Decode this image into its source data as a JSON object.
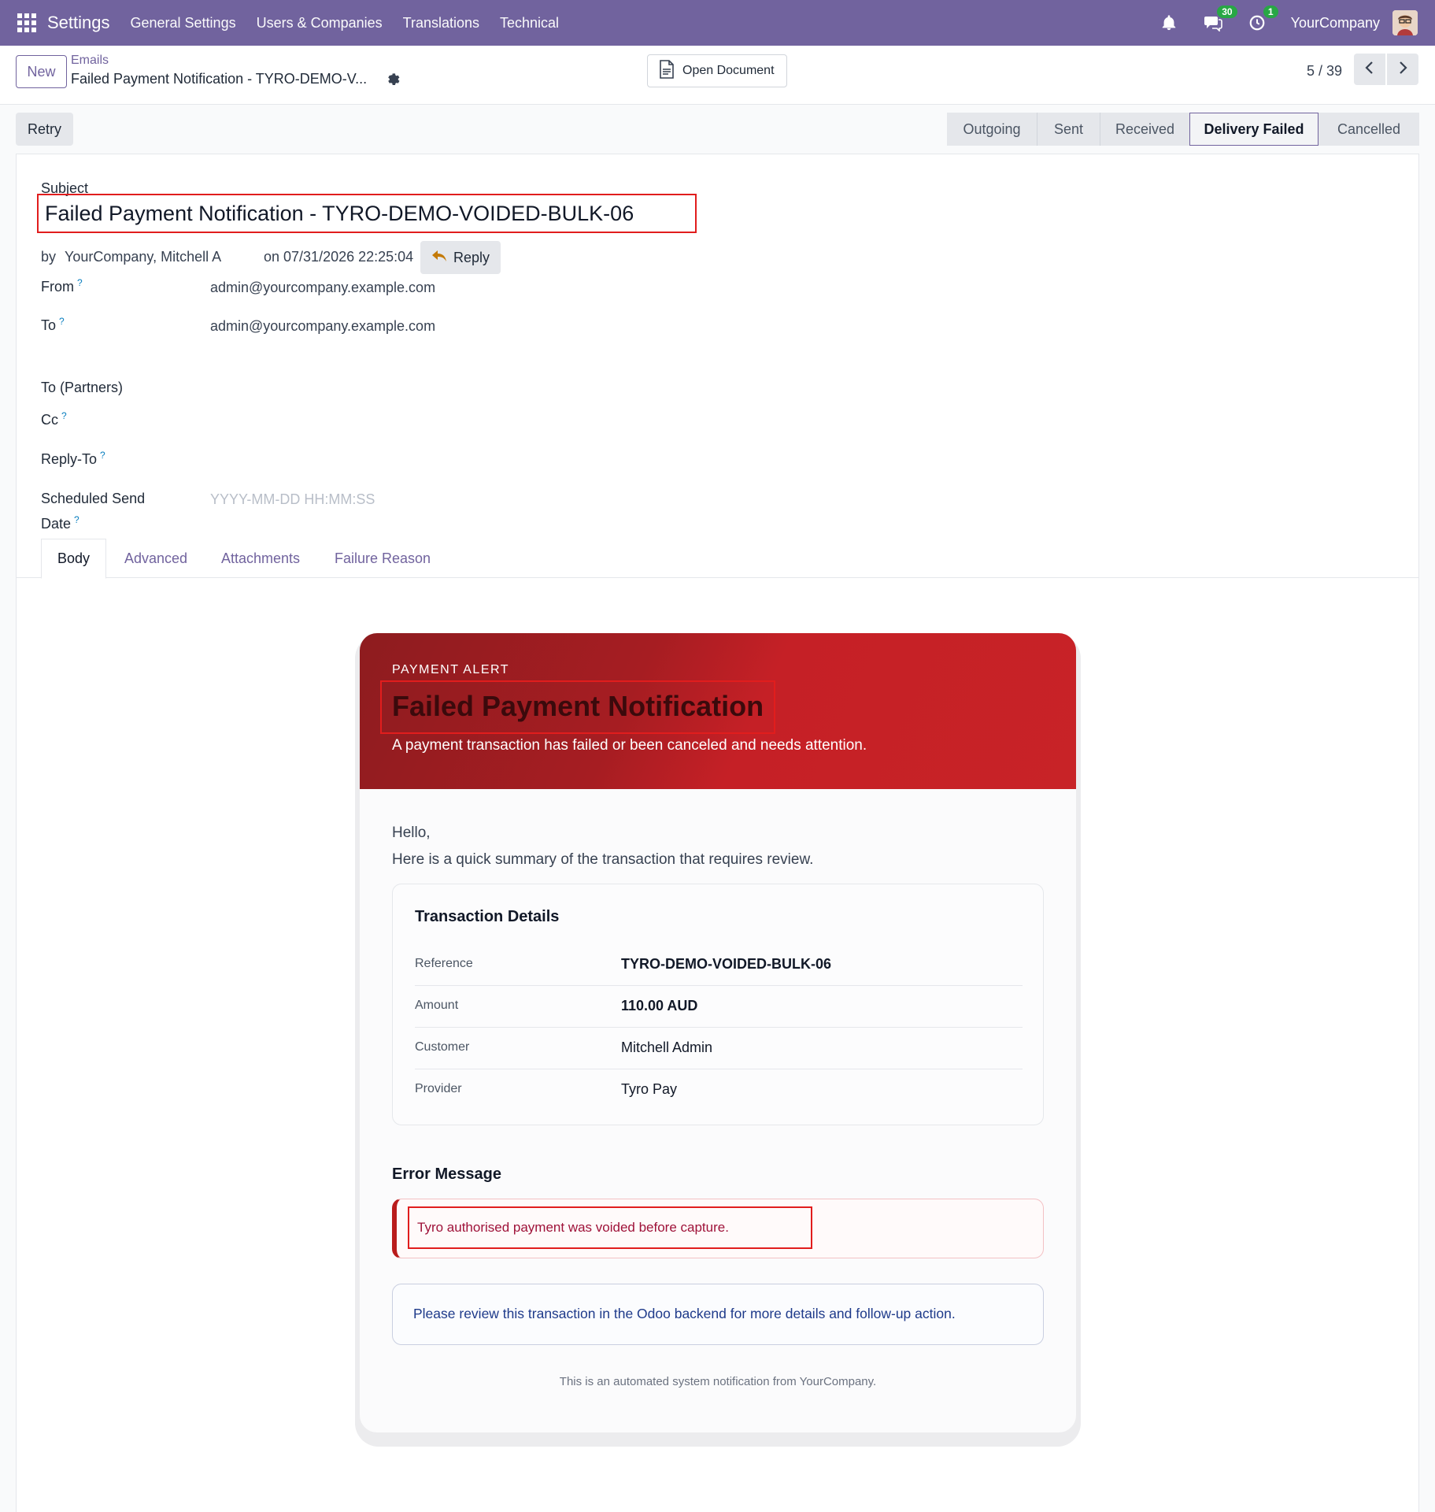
{
  "navbar": {
    "brand": "Settings",
    "menus": [
      "General Settings",
      "Users & Companies",
      "Translations",
      "Technical"
    ],
    "messages_count": "30",
    "activities_count": "1",
    "company": "YourCompany"
  },
  "control": {
    "new_label": "New",
    "breadcrumb_parent": "Emails",
    "breadcrumb_current": "Failed Payment Notification - TYRO-DEMO-V...",
    "open_document_label": "Open Document",
    "pager": "5 / 39"
  },
  "actions": {
    "retry_label": "Retry"
  },
  "statusbar": {
    "stages": [
      "Outgoing",
      "Sent",
      "Received",
      "Delivery Failed",
      "Cancelled"
    ],
    "active": "Delivery Failed"
  },
  "form": {
    "subject_label": "Subject",
    "subject": "Failed Payment Notification - TYRO-DEMO-VOIDED-BULK-06",
    "by_prefix": "by",
    "author": "YourCompany, Mitchell A",
    "date": "on 07/31/2026 22:25:04",
    "reply_label": "Reply",
    "from_label": "From",
    "from_value": "admin@yourcompany.example.com",
    "to_label": "To",
    "to_value": "admin@yourcompany.example.com",
    "to_partners_label": "To (Partners)",
    "cc_label": "Cc",
    "reply_to_label": "Reply-To",
    "scheduled_label_1": "Scheduled Send",
    "scheduled_label_2": "Date",
    "scheduled_placeholder": "YYYY-MM-DD HH:MM:SS",
    "help_mark": "?"
  },
  "tabs": [
    "Body",
    "Advanced",
    "Attachments",
    "Failure Reason"
  ],
  "email": {
    "kicker": "PAYMENT ALERT",
    "title": "Failed Payment Notification",
    "subtitle": "A payment transaction has failed or been canceled and needs attention.",
    "greeting": "Hello,",
    "intro": "Here is a quick summary of the transaction that requires review.",
    "details_title": "Transaction Details",
    "details": [
      {
        "key": "Reference",
        "value": "TYRO-DEMO-VOIDED-BULK-06"
      },
      {
        "key": "Amount",
        "value": "110.00 AUD"
      },
      {
        "key": "Customer",
        "value": "Mitchell Admin"
      },
      {
        "key": "Provider",
        "value": "Tyro Pay"
      }
    ],
    "error_title": "Error Message",
    "error_text": "Tyro authorised payment was voided before capture.",
    "note": "Please review this transaction in the Odoo backend for more details and follow-up action.",
    "footer": "This is an automated system notification from YourCompany."
  },
  "colors": {
    "brand": "#71639e",
    "danger": "#c52026",
    "highlight": "#e11d1d"
  }
}
